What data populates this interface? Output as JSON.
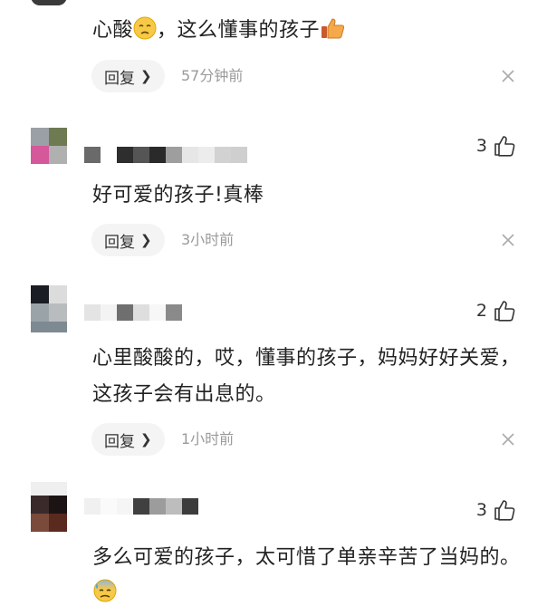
{
  "comments": [
    {
      "text": "心酸😔，这么懂事的孩子👍",
      "reply_label": "回复",
      "time": "57分钟前"
    },
    {
      "likes": "3",
      "text": "好可爱的孩子!真棒",
      "reply_label": "回复",
      "time": "3小时前"
    },
    {
      "likes": "2",
      "text": "心里酸酸的，哎，懂事的孩子，妈妈好好关爱，这孩子会有出息的。",
      "reply_label": "回复",
      "time": "1小时前"
    },
    {
      "likes": "3",
      "text": "多么可爱的孩子，太可惜了单亲辛苦了当妈的。😓"
    }
  ],
  "icons": {
    "like": "thumbs-up-outline-icon",
    "dismiss": "close-x-icon",
    "chevron": "chevron-right-icon"
  },
  "colors": {
    "reply_bg": "#f4f4f4",
    "time_text": "#9a9a9a"
  }
}
